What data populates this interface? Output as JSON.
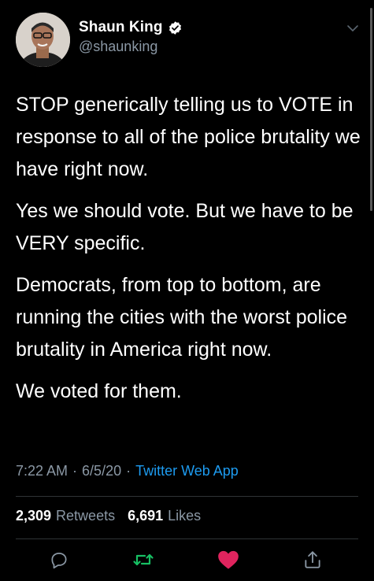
{
  "author": {
    "display_name": "Shaun King",
    "handle": "@shaunking",
    "verified_icon": "verified-badge-icon"
  },
  "tweet": {
    "paragraphs": [
      "STOP generically telling us to VOTE in response to all of the police brutality we have right now.",
      "Yes we should vote. But we have to be VERY specific.",
      "Democrats, from top to bottom, are running the cities with the worst police brutality in America right now.",
      "We voted for them."
    ],
    "time": "7:22 AM",
    "separator": "·",
    "date": "6/5/20",
    "source": "Twitter Web App"
  },
  "stats": {
    "retweets_count": "2,309",
    "retweets_label": "Retweets",
    "likes_count": "6,691",
    "likes_label": "Likes"
  },
  "actions": [
    {
      "name": "reply",
      "icon": "reply-icon"
    },
    {
      "name": "retweet",
      "icon": "retweet-icon",
      "color": "#17bf63"
    },
    {
      "name": "like",
      "icon": "heart-icon",
      "color": "#e0245e",
      "active": true
    },
    {
      "name": "share",
      "icon": "share-icon"
    }
  ],
  "colors": {
    "background": "#000000",
    "secondary_text": "#8b98a5",
    "link": "#1d9bf0",
    "retweet_green": "#17bf63",
    "like_pink": "#e0245e"
  }
}
